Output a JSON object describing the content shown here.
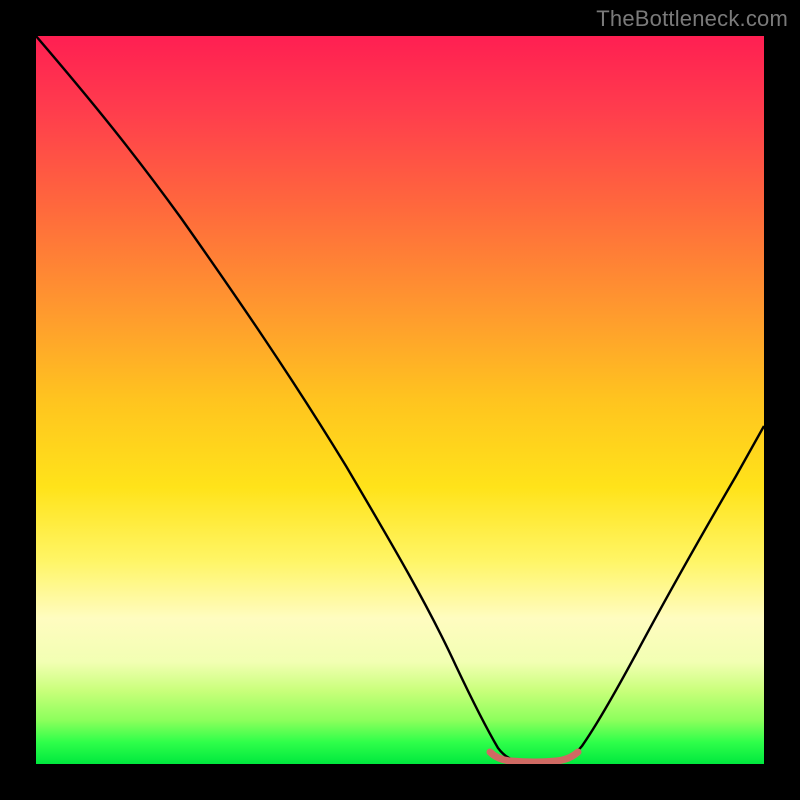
{
  "watermark": "TheBottleneck.com",
  "chart_data": {
    "type": "line",
    "title": "",
    "xlabel": "",
    "ylabel": "",
    "xlim": [
      0,
      100
    ],
    "ylim": [
      0,
      100
    ],
    "series": [
      {
        "name": "bottleneck-curve",
        "x": [
          0,
          6,
          12,
          18,
          24,
          30,
          36,
          42,
          48,
          54,
          58,
          62,
          66,
          70,
          74,
          80,
          86,
          92,
          100
        ],
        "values": [
          100,
          92,
          84,
          75,
          66,
          56,
          46,
          36,
          26,
          15,
          8,
          3,
          1,
          1,
          3,
          10,
          20,
          32,
          48
        ]
      },
      {
        "name": "optimal-marker",
        "x": [
          58,
          60,
          62,
          64,
          66,
          68,
          70,
          72
        ],
        "values": [
          2.0,
          1.2,
          1.0,
          1.0,
          1.0,
          1.0,
          1.2,
          2.0
        ]
      }
    ],
    "colors": {
      "curve": "#000000",
      "marker": "#cf6a63",
      "gradient_top": "#ff1f52",
      "gradient_bottom": "#00e83e"
    }
  }
}
